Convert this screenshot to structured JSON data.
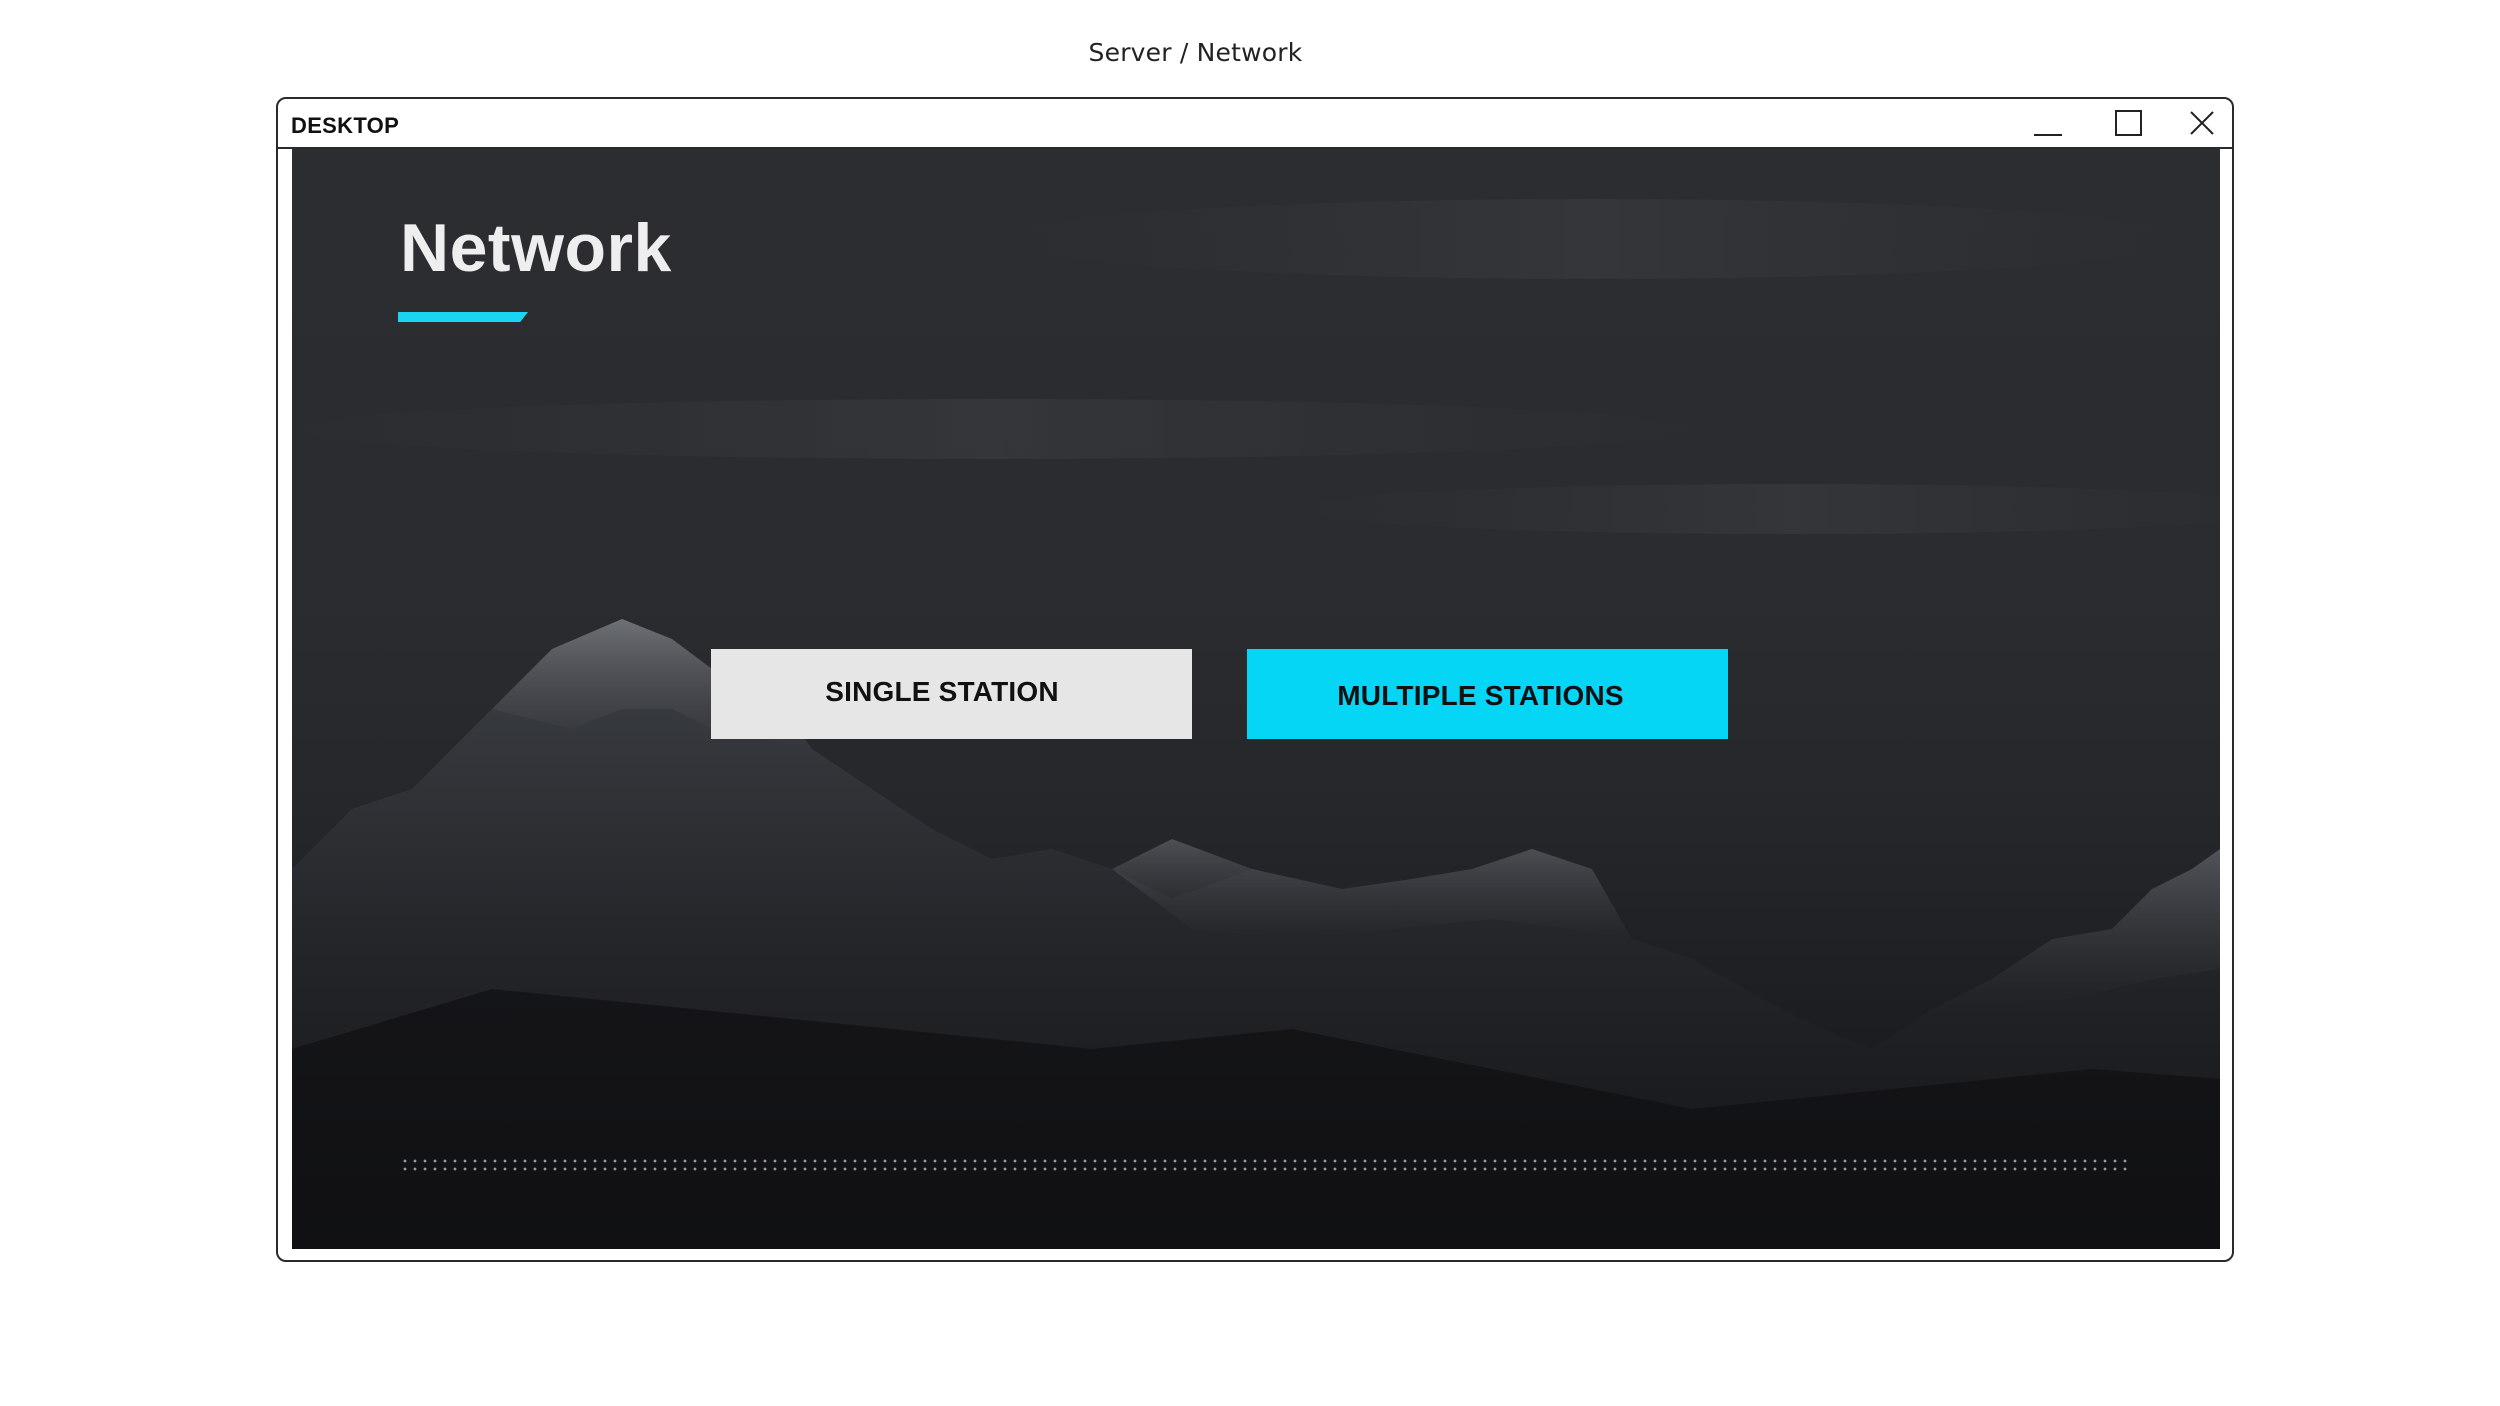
{
  "caption": "Server / Network",
  "window": {
    "title": "DESKTOP",
    "controls": {
      "minimize_icon": "minimize-icon",
      "maximize_icon": "maximize-icon",
      "close_icon": "close-icon"
    }
  },
  "main": {
    "title": "Network",
    "buttons": {
      "single_station": "SINGLE STATION",
      "multiple_stations": "MULTIPLE STATIONS"
    }
  },
  "colors": {
    "accent": "#05d6f5",
    "secondary_button": "#e6e6e6",
    "background": "#2a2c30"
  }
}
